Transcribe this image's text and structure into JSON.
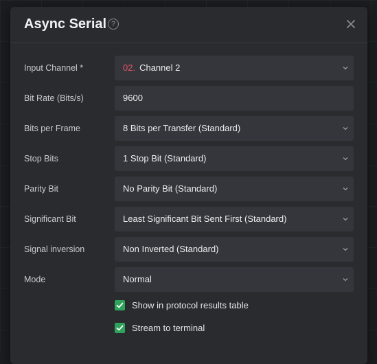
{
  "dialog": {
    "title": "Async Serial",
    "help_icon": "question-circle-icon",
    "close_icon": "close-icon"
  },
  "fields": [
    {
      "label": "Input Channel *",
      "type": "select",
      "prefix": "02.",
      "value": "Channel 2"
    },
    {
      "label": "Bit Rate (Bits/s)",
      "type": "input",
      "value": "9600"
    },
    {
      "label": "Bits per Frame",
      "type": "select",
      "value": "8 Bits per Transfer (Standard)"
    },
    {
      "label": "Stop Bits",
      "type": "select",
      "value": "1 Stop Bit (Standard)"
    },
    {
      "label": "Parity Bit",
      "type": "select",
      "value": "No Parity Bit (Standard)"
    },
    {
      "label": "Significant Bit",
      "type": "select",
      "value": "Least Significant Bit Sent First (Standard)"
    },
    {
      "label": "Signal inversion",
      "type": "select",
      "value": "Non Inverted (Standard)"
    },
    {
      "label": "Mode",
      "type": "select",
      "value": "Normal"
    }
  ],
  "checkboxes": [
    {
      "label": "Show in protocol results table",
      "checked": true
    },
    {
      "label": "Stream to terminal",
      "checked": true
    }
  ],
  "colors": {
    "accent_check": "#2fa35c",
    "channel_prefix": "#e25564"
  }
}
